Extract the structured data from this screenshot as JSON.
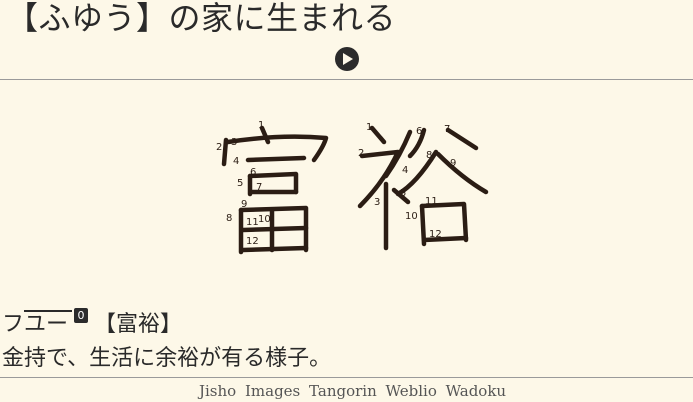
{
  "header": {
    "sentence": "【ふゆう】の家に生まれる",
    "play_icon": "play-circle-icon"
  },
  "kanji": {
    "characters": [
      "富",
      "裕"
    ],
    "stroke_numbers_1": [
      "1",
      "2",
      "3",
      "4",
      "5",
      "6",
      "7",
      "8",
      "9",
      "10",
      "11",
      "12"
    ],
    "stroke_numbers_2": [
      "1",
      "2",
      "3",
      "4",
      "5",
      "6",
      "7",
      "8",
      "9",
      "10",
      "11",
      "12"
    ]
  },
  "entry": {
    "reading": "フユー",
    "accent": "0",
    "kanji_form": "【富裕】",
    "definition": "金持で、生活に余裕が有る様子。"
  },
  "links": [
    "Jisho",
    "Images",
    "Tangorin",
    "Weblio",
    "Wadoku"
  ],
  "colors": {
    "background": "#fdf8e8",
    "stroke": "#2b1d14",
    "rule": "#9a9a9a"
  }
}
